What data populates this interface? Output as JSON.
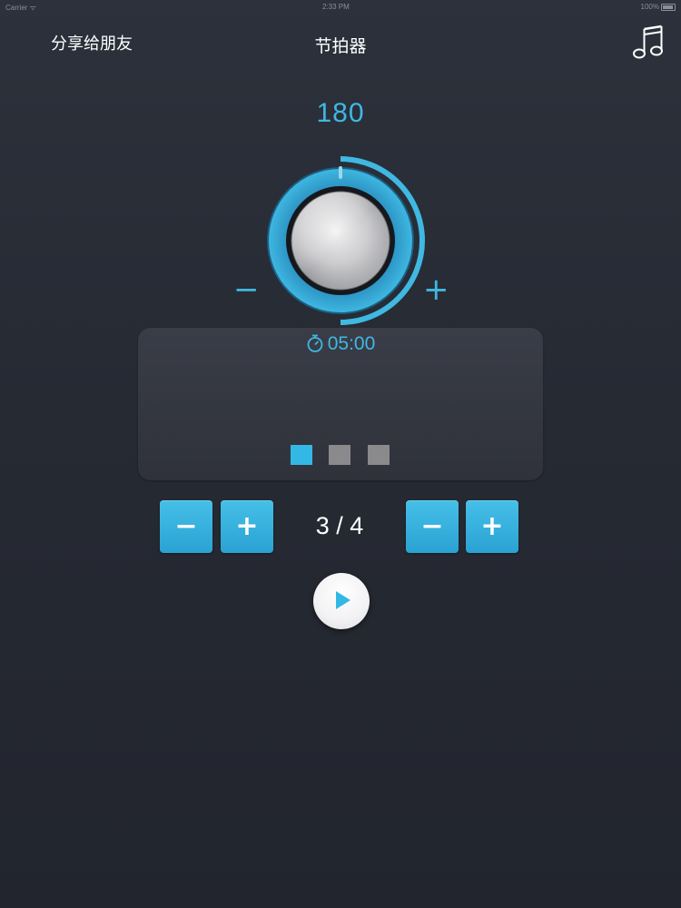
{
  "status_bar": {
    "carrier": "Carrier ᯤ",
    "time": "2:33 PM",
    "battery": "100%"
  },
  "nav": {
    "share_label": "分享给朋友",
    "title": "节拍器",
    "music_icon": "music-note-icon"
  },
  "tempo": {
    "bpm": "180",
    "dial_minus": "−",
    "dial_plus": "+",
    "dial_level": 0.5
  },
  "timer": {
    "icon": "stopwatch-icon",
    "value": "05:00"
  },
  "beats": {
    "total": 3,
    "active_index": 0,
    "colors": {
      "active": "#33b8e6",
      "inactive": "#8a8a8c"
    }
  },
  "time_signature": {
    "label": "3 / 4",
    "beats_minus": "−",
    "beats_plus": "+",
    "note_minus": "−",
    "note_plus": "+"
  },
  "play": {
    "icon": "play-icon"
  },
  "colors": {
    "accent": "#3fb8e2",
    "background": "#262a33"
  }
}
